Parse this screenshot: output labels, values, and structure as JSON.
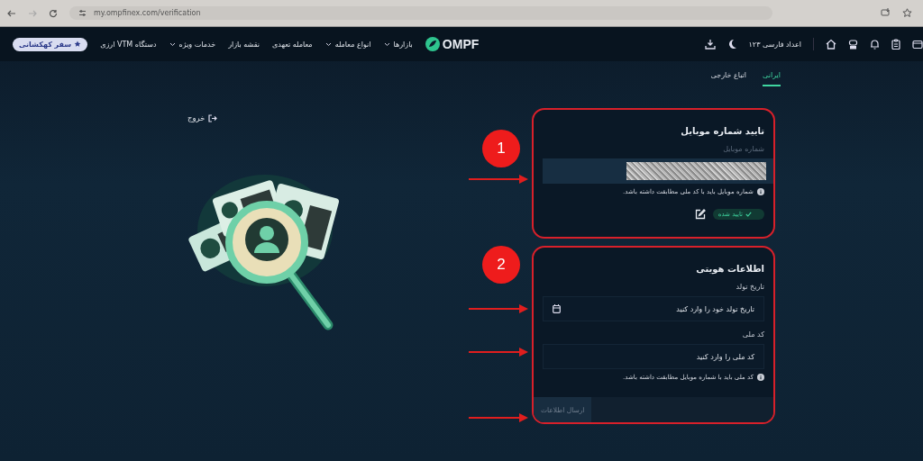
{
  "browser": {
    "url": "my.ompfinex.com/verification"
  },
  "nav": {
    "logo": "OMPF",
    "menu": [
      {
        "label": "بازارها",
        "dropdown": true
      },
      {
        "label": "انواع معامله",
        "dropdown": true
      },
      {
        "label": "معامله تعهدی",
        "dropdown": false
      },
      {
        "label": "نقشه بازار",
        "dropdown": false
      },
      {
        "label": "خدمات ویژه",
        "dropdown": true
      },
      {
        "label": "دستگاه VTM ارزی",
        "dropdown": false
      }
    ],
    "badge": "سفر کهکشانی",
    "digits_toggle": "اعداد فارسی ۱۲۳"
  },
  "tabs": [
    {
      "label": "ایرانی",
      "selected": true
    },
    {
      "label": "اتباع خارجی",
      "selected": false
    }
  ],
  "exit": "خروج",
  "mobile_card": {
    "number": "1",
    "title": "تایید شماره موبایل",
    "field_label": "شماره موبایل",
    "hint": "شماره موبایل باید با کد ملی مطابقت داشته باشد.",
    "status": "تایید شده",
    "verified": true
  },
  "identity_card": {
    "number": "2",
    "title": "اطلاعات هویتی",
    "fields": [
      {
        "label": "تاریخ تولد",
        "placeholder": "تاریخ تولد خود را وارد کنید",
        "kind": "date"
      },
      {
        "label": "کد ملی",
        "placeholder": "کد ملی را وارد کنید",
        "kind": "text"
      }
    ],
    "hint": "کد ملی باید با شماره موبایل مطابقت داشته باشد.",
    "submit": {
      "label": "ارسال اطلاعات",
      "disabled": true
    }
  }
}
